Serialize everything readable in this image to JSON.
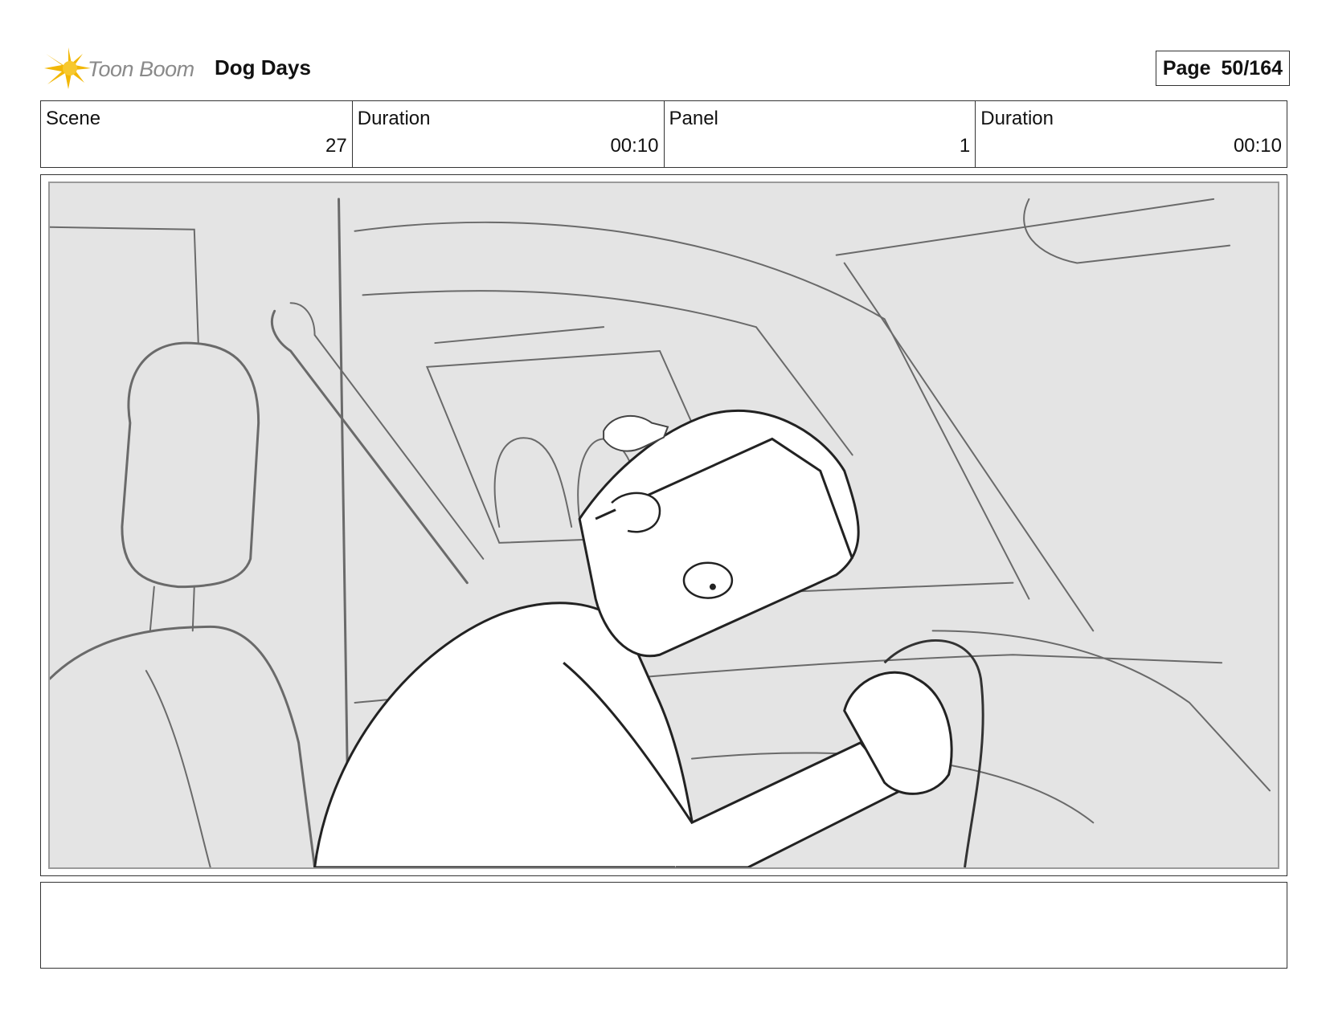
{
  "header": {
    "logo_text": "Toon Boom",
    "project_title": "Dog Days",
    "page_label": "Page",
    "page_number": "50/164"
  },
  "info": {
    "scene_label": "Scene",
    "scene_value": "27",
    "scene_duration_label": "Duration",
    "scene_duration_value": "00:10",
    "panel_label": "Panel",
    "panel_value": "1",
    "panel_duration_label": "Duration",
    "panel_duration_value": "00:10"
  },
  "colors": {
    "logo_accent": "#f2b705",
    "panel_background": "#e4e4e4",
    "sketch_line": "#5a5a5a"
  },
  "notes": {
    "text": ""
  }
}
